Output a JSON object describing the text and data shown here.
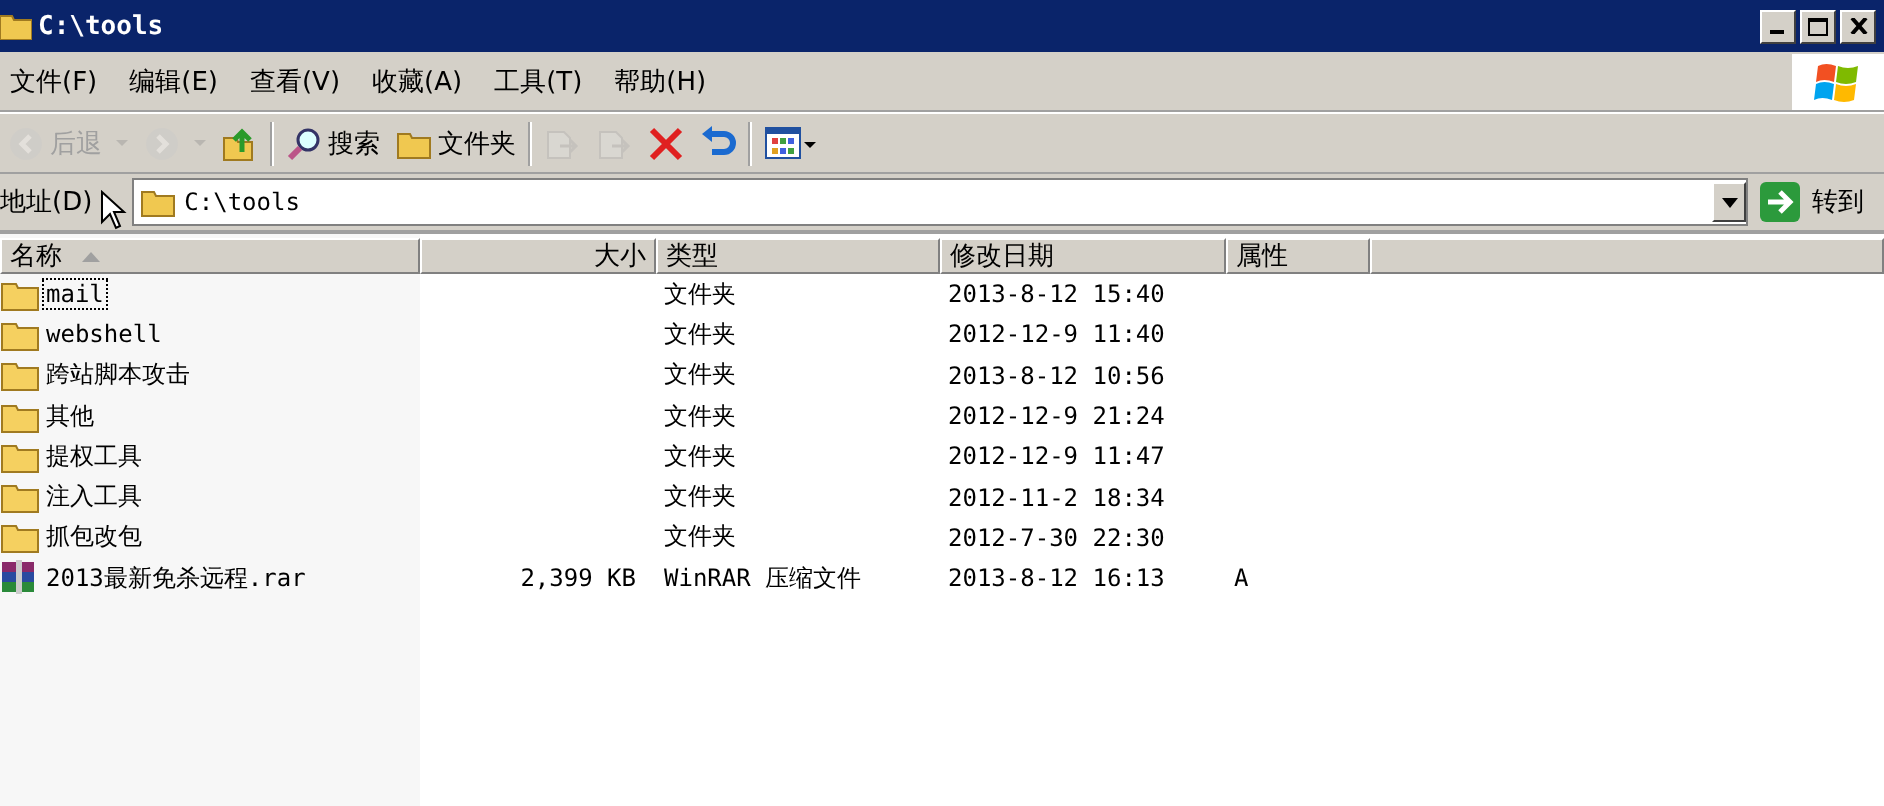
{
  "window": {
    "title": "C:\\tools"
  },
  "menu": [
    {
      "label": "文件(F)"
    },
    {
      "label": "编辑(E)"
    },
    {
      "label": "查看(V)"
    },
    {
      "label": "收藏(A)"
    },
    {
      "label": "工具(T)"
    },
    {
      "label": "帮助(H)"
    }
  ],
  "toolbar": [
    {
      "kind": "back",
      "label": "后退",
      "disabled": true
    },
    {
      "kind": "forward",
      "disabled": true
    },
    {
      "kind": "up",
      "disabled": false
    },
    {
      "kind": "sep"
    },
    {
      "kind": "search",
      "label": "搜索",
      "disabled": false
    },
    {
      "kind": "folders",
      "label": "文件夹",
      "disabled": false
    },
    {
      "kind": "sep"
    },
    {
      "kind": "move",
      "disabled": true
    },
    {
      "kind": "copy",
      "disabled": true
    },
    {
      "kind": "delete",
      "disabled": false
    },
    {
      "kind": "undo",
      "disabled": false
    },
    {
      "kind": "sep"
    },
    {
      "kind": "views",
      "disabled": false
    }
  ],
  "address": {
    "label": "地址(D)",
    "value": "C:\\tools",
    "go": "转到"
  },
  "columns": [
    {
      "label": "名称",
      "sorted": true
    },
    {
      "label": "大小",
      "sorted": false
    },
    {
      "label": "类型",
      "sorted": false
    },
    {
      "label": "修改日期",
      "sorted": false
    },
    {
      "label": "属性",
      "sorted": false
    }
  ],
  "rows": [
    {
      "kind": "folder",
      "name": "mail",
      "size": "",
      "type": "文件夹",
      "date": "2013-8-12 15:40",
      "attr": "",
      "focused": true
    },
    {
      "kind": "folder",
      "name": "webshell",
      "type": "文件夹",
      "date": "2012-12-9 11:40",
      "focused": false
    },
    {
      "kind": "folder",
      "name": "跨站脚本攻击",
      "type": "文件夹",
      "date": "2013-8-12 10:56",
      "focused": false
    },
    {
      "kind": "folder",
      "name": "其他",
      "type": "文件夹",
      "date": "2012-12-9 21:24",
      "focused": false
    },
    {
      "kind": "folder",
      "name": "提权工具",
      "type": "文件夹",
      "date": "2012-12-9 11:47",
      "focused": false
    },
    {
      "kind": "folder",
      "name": "注入工具",
      "type": "文件夹",
      "date": "2012-11-2 18:34",
      "focused": false
    },
    {
      "kind": "folder",
      "name": "抓包改包",
      "type": "文件夹",
      "date": "2012-7-30 22:30",
      "focused": false
    },
    {
      "kind": "archive",
      "name": "2013最新免杀远程.rar",
      "size": "2,399 KB",
      "type": "WinRAR 压缩文件",
      "date": "2013-8-12 16:13",
      "attr": "A",
      "focused": false
    }
  ]
}
